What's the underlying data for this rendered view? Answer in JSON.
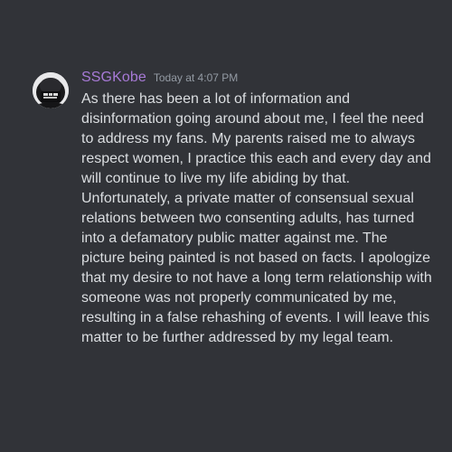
{
  "message": {
    "username": "SSGKobe",
    "timestamp": "Today at 4:07 PM",
    "avatar_icon": "user-avatar-icon",
    "text": "As there has been a lot of information and disinformation going around about me, I feel the need to address my fans. My parents raised me to always respect women, I practice this each and every day and will continue to live my life abiding by that. Unfortunately, a private matter of consensual sexual relations between two consenting adults, has turned into a defamatory public matter against me. The picture being painted is not based on facts. I apologize that my desire to not have a long term relationship with someone was not properly communicated by me, resulting in a false rehashing of events. I will leave this matter to be further addressed by my legal team."
  },
  "colors": {
    "background": "#313338",
    "username": "#a77ad6",
    "timestamp": "#949ba4",
    "text": "#dbdee1"
  }
}
